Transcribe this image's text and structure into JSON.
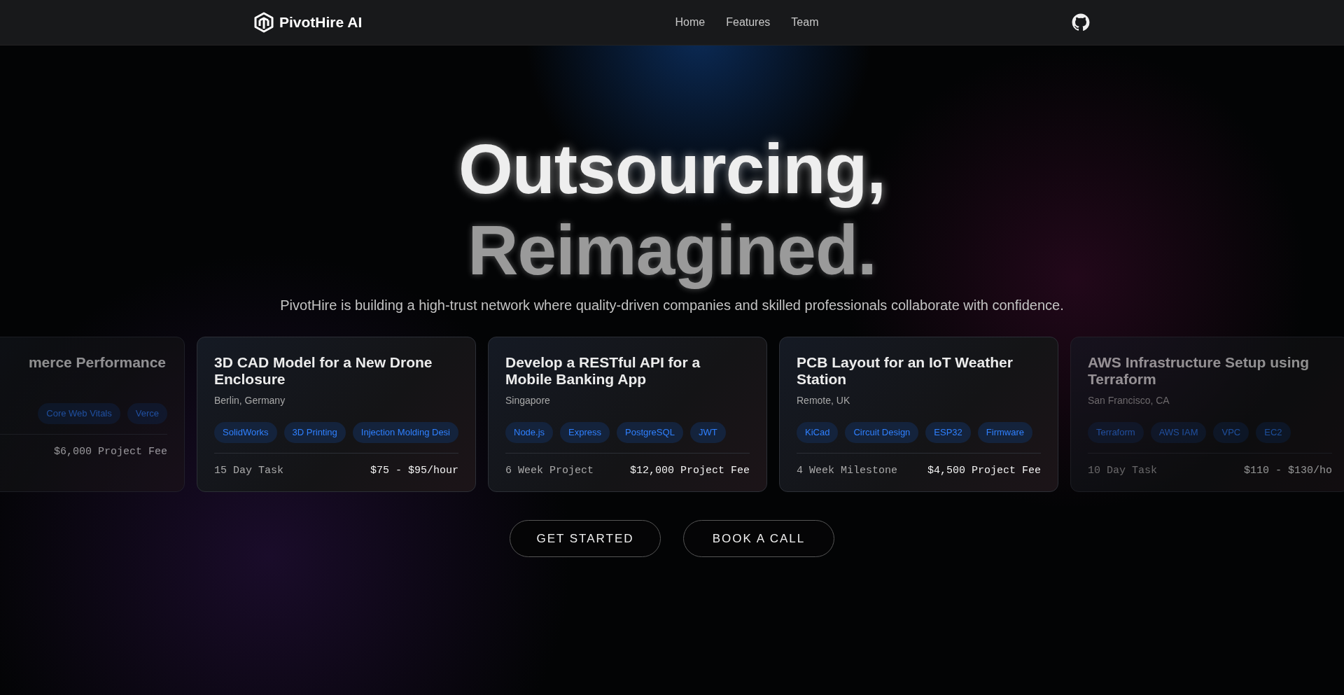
{
  "header": {
    "brand": "PivotHire AI",
    "nav": [
      {
        "label": "Home"
      },
      {
        "label": "Features"
      },
      {
        "label": "Team"
      }
    ]
  },
  "hero": {
    "title_lines": [
      "Outsourcing,",
      "Reimagined."
    ],
    "subtitle": "PivotHire is building a high-trust network where quality-driven companies and skilled professionals collaborate with confidence."
  },
  "cards": [
    {
      "title": "merce Performance",
      "tags": [
        "Core Web Vitals",
        "Verce"
      ],
      "price": "$6,000 Project Fee",
      "faded": true
    },
    {
      "title": "3D CAD Model for a New Drone Enclosure",
      "location": "Berlin, Germany",
      "tags": [
        "SolidWorks",
        "3D Printing",
        "Injection Molding Desi"
      ],
      "duration": "15 Day Task",
      "price": "$75 - $95/hour",
      "faded": false
    },
    {
      "title": "Develop a RESTful API for a Mobile Banking App",
      "location": "Singapore",
      "tags": [
        "Node.js",
        "Express",
        "PostgreSQL",
        "JWT"
      ],
      "duration": "6 Week Project",
      "price": "$12,000 Project Fee",
      "faded": false
    },
    {
      "title": "PCB Layout for an IoT Weather Station",
      "location": "Remote, UK",
      "tags": [
        "KiCad",
        "Circuit Design",
        "ESP32",
        "Firmware"
      ],
      "duration": "4 Week Milestone",
      "price": "$4,500 Project Fee",
      "faded": false
    },
    {
      "title": "AWS Infrastructure Setup using Terraform",
      "location": "San Francisco, CA",
      "tags": [
        "Terraform",
        "AWS IAM",
        "VPC",
        "EC2"
      ],
      "duration": "10 Day Task",
      "price": "$110 - $130/ho",
      "faded": true
    }
  ],
  "buttons": [
    {
      "label": "GET STARTED"
    },
    {
      "label": "BOOK A CALL"
    }
  ]
}
